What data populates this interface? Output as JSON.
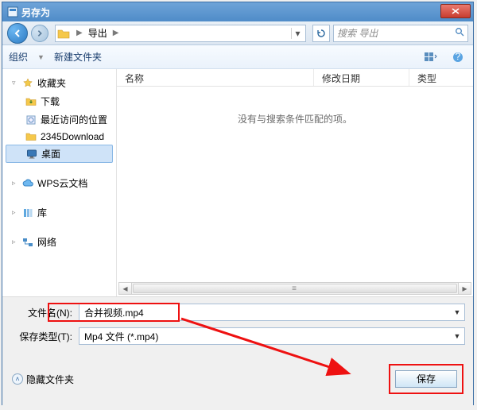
{
  "window": {
    "title": "另存为"
  },
  "nav": {
    "breadcrumb_item": "导出",
    "search_placeholder": "搜索 导出"
  },
  "toolbar": {
    "organize": "组织",
    "new_folder": "新建文件夹"
  },
  "tree": {
    "favorites": {
      "label": "收藏夹",
      "items": [
        "下载",
        "最近访问的位置",
        "2345Download",
        "桌面"
      ]
    },
    "wps": {
      "label": "WPS云文档"
    },
    "libraries": {
      "label": "库"
    },
    "network": {
      "label": "网络"
    }
  },
  "columns": {
    "name": "名称",
    "date": "修改日期",
    "type": "类型"
  },
  "empty_message": "没有与搜索条件匹配的项。",
  "fields": {
    "filename_label": "文件名(N):",
    "filename_value": "合并视频.mp4",
    "filetype_label": "保存类型(T):",
    "filetype_value": "Mp4 文件 (*.mp4)"
  },
  "footer": {
    "hide_folders": "隐藏文件夹",
    "save": "保存"
  }
}
